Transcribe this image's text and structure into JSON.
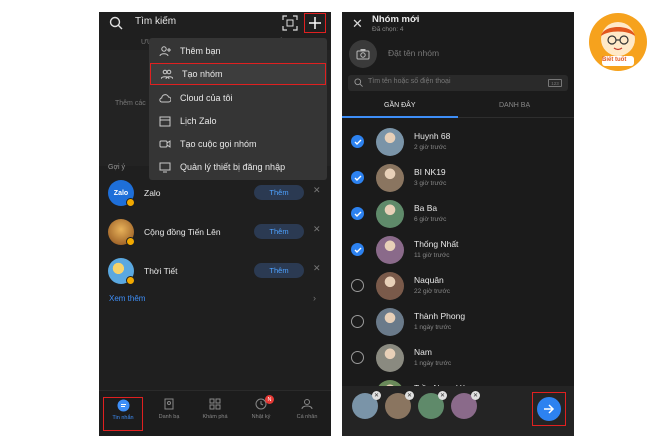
{
  "left": {
    "search_placeholder": "Tìm kiếm",
    "tabs": [
      "ƯU",
      "Ư",
      "Ả"
    ],
    "hint": "Thêm các",
    "menu": [
      {
        "label": "Thêm bạn",
        "icon": "add-friend-icon"
      },
      {
        "label": "Tạo nhóm",
        "icon": "create-group-icon"
      },
      {
        "label": "Cloud của tôi",
        "icon": "cloud-icon"
      },
      {
        "label": "Lịch Zalo",
        "icon": "calendar-icon"
      },
      {
        "label": "Tạo cuộc gọi nhóm",
        "icon": "group-call-icon"
      },
      {
        "label": "Quản lý thiết bị đăng nhập",
        "icon": "device-icon"
      }
    ],
    "suggest_label": "Gợi ý",
    "suggestions": [
      {
        "name": "Zalo",
        "action": "Thêm",
        "avatar_color": "#1e6fd9"
      },
      {
        "name": "Cộng đồng Tiến Lên",
        "action": "Thêm",
        "avatar_color": "#c9892b"
      },
      {
        "name": "Thời Tiết",
        "action": "Thêm",
        "avatar_color": "#4a9fd8"
      }
    ],
    "see_more": "Xem thêm",
    "nav": [
      {
        "label": "Tin nhắn",
        "icon": "chat-icon",
        "active": true
      },
      {
        "label": "Danh bạ",
        "icon": "contacts-icon"
      },
      {
        "label": "Khám phá",
        "icon": "discover-icon"
      },
      {
        "label": "Nhật ký",
        "icon": "timeline-icon",
        "badge": "N"
      },
      {
        "label": "Cá nhân",
        "icon": "profile-icon"
      }
    ]
  },
  "right": {
    "title": "Nhóm mới",
    "subtitle": "Đã chọn: 4",
    "group_name_placeholder": "Đặt tên nhóm",
    "search_placeholder": "Tìm tên hoặc số điện thoại",
    "keyboard_label": "123",
    "tabs": [
      "GẦN ĐÂY",
      "DANH BẠ"
    ],
    "contacts": [
      {
        "name": "Huynh 68",
        "time": "2 giờ trước",
        "checked": true,
        "avatar_color": "#7a94a8"
      },
      {
        "name": "BI NK19",
        "time": "3 giờ trước",
        "checked": true,
        "avatar_color": "#8a7560"
      },
      {
        "name": "Ba Ba",
        "time": "6 giờ trước",
        "checked": true,
        "avatar_color": "#5f8a6a"
      },
      {
        "name": "Thống Nhất",
        "time": "11 giờ trước",
        "checked": true,
        "avatar_color": "#8a6a8a"
      },
      {
        "name": "Naquân",
        "time": "22 giờ trước",
        "checked": false,
        "avatar_color": "#7a5a4a"
      },
      {
        "name": "Thành Phong",
        "time": "1 ngày trước",
        "checked": false,
        "avatar_color": "#6a7a8a"
      },
      {
        "name": "Nam",
        "time": "1 ngày trước",
        "checked": false,
        "avatar_color": "#8a8a80"
      },
      {
        "name": "Trần Ngọc Hà",
        "time": "",
        "checked": false,
        "avatar_color": "#6a8a5a"
      }
    ],
    "selected_avatars": [
      "#7a94a8",
      "#8a7560",
      "#5f8a6a",
      "#8a6a8a"
    ]
  },
  "logo": {
    "text": "Biết tuốt",
    "bg": "#f6a21d"
  }
}
